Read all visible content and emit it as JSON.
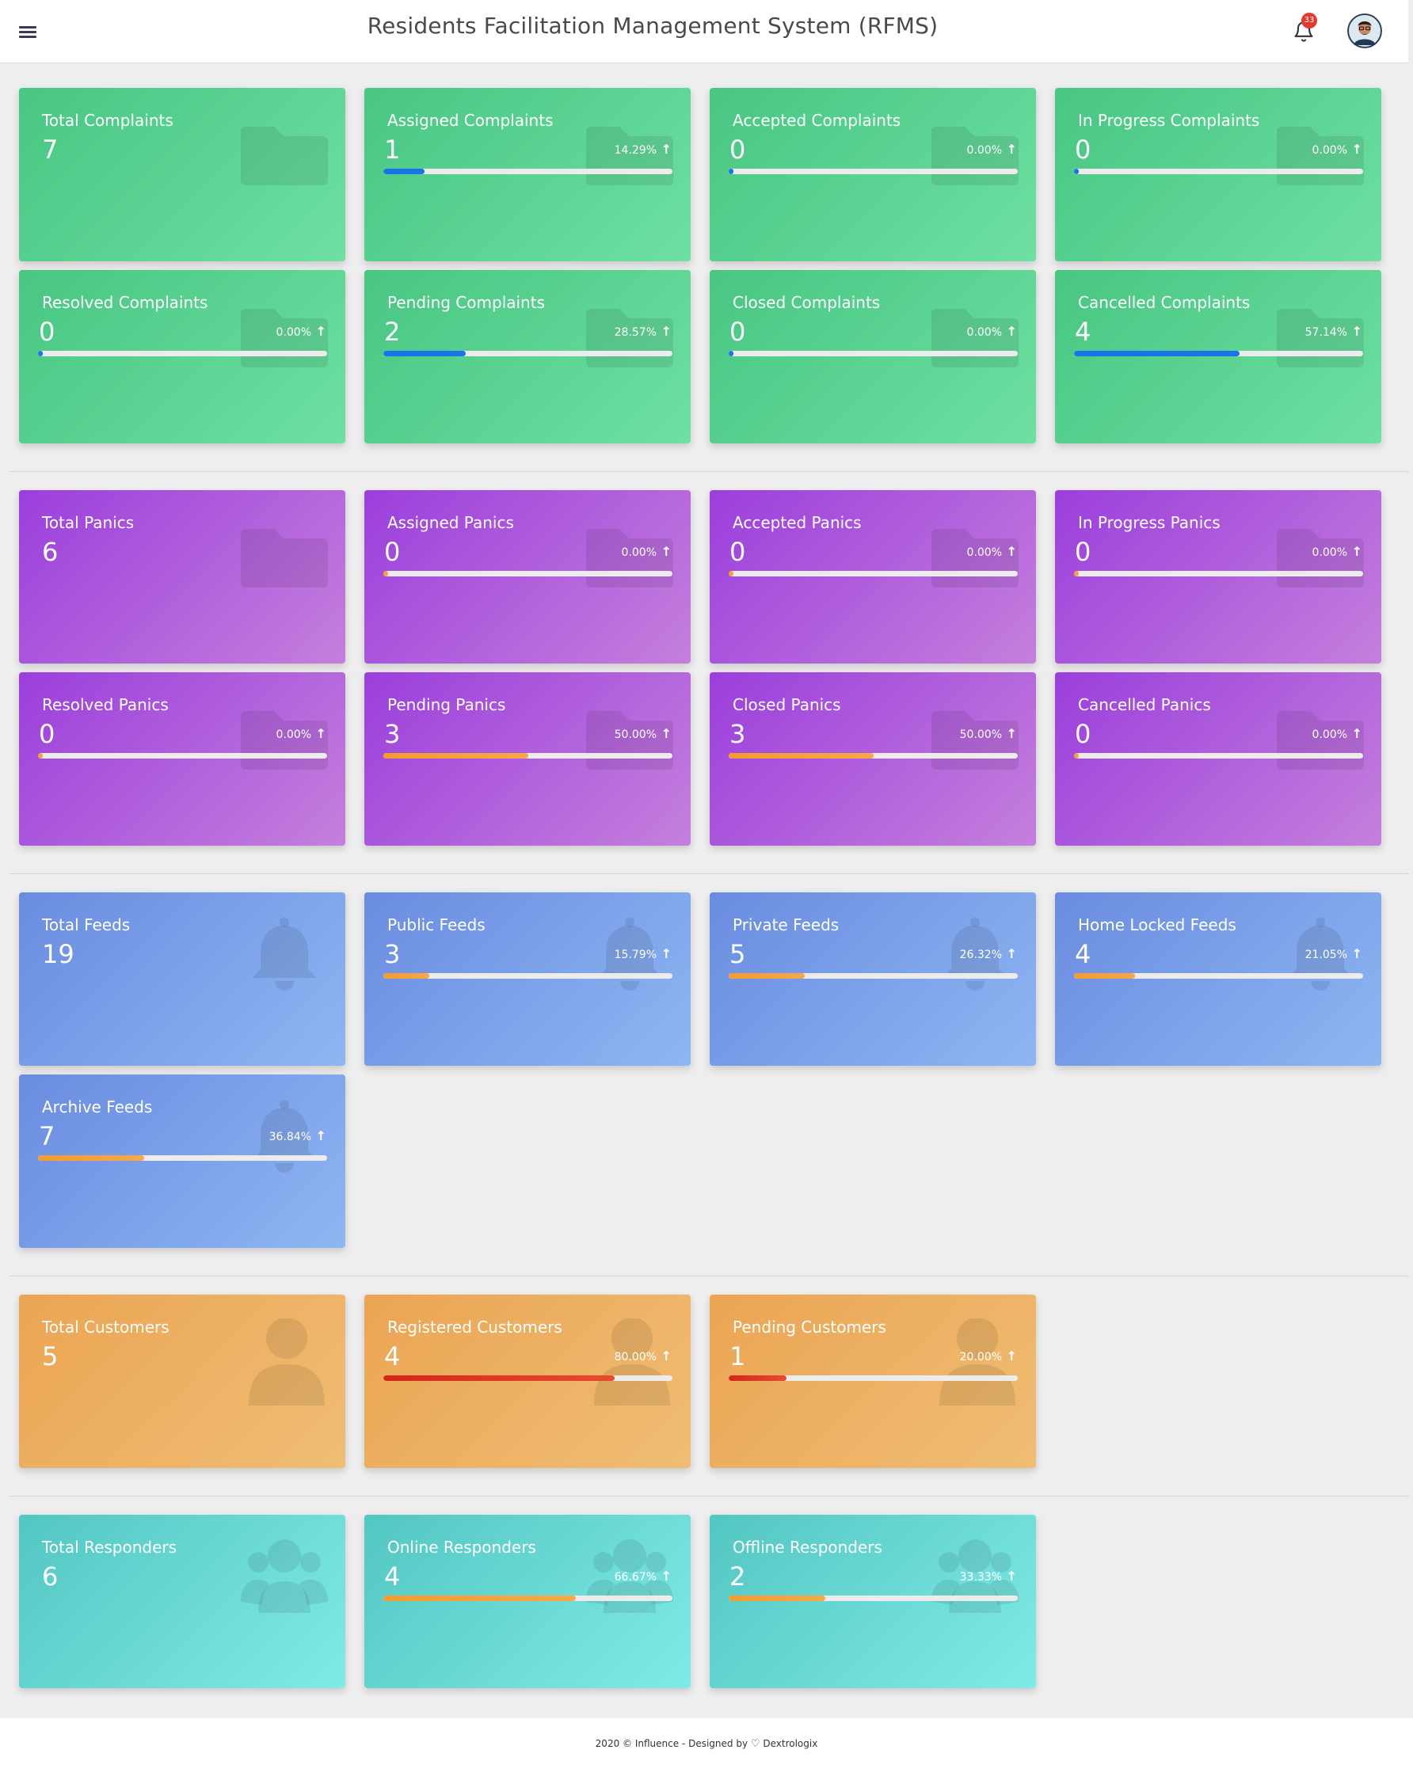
{
  "header": {
    "title": "Residents Facilitation Management System (RFMS)",
    "notification_count": "33"
  },
  "sections": [
    {
      "name": "complaints",
      "theme": "green",
      "icon": "folder-icon",
      "bar_color": "blue",
      "cards": [
        {
          "title": "Total Complaints",
          "value": "7"
        },
        {
          "title": "Assigned Complaints",
          "value": "1",
          "percent": "14.29%",
          "progress": 0.1429
        },
        {
          "title": "Accepted Complaints",
          "value": "0",
          "percent": "0.00%",
          "progress": 0
        },
        {
          "title": "In Progress Complaints",
          "value": "0",
          "percent": "0.00%",
          "progress": 0
        },
        {
          "title": "Resolved Complaints",
          "value": "0",
          "percent": "0.00%",
          "progress": 0
        },
        {
          "title": "Pending Complaints",
          "value": "2",
          "percent": "28.57%",
          "progress": 0.2857
        },
        {
          "title": "Closed Complaints",
          "value": "0",
          "percent": "0.00%",
          "progress": 0
        },
        {
          "title": "Cancelled Complaints",
          "value": "4",
          "percent": "57.14%",
          "progress": 0.5714
        }
      ]
    },
    {
      "name": "panics",
      "theme": "purple",
      "icon": "folder-icon",
      "bar_color": "orange",
      "cards": [
        {
          "title": "Total Panics",
          "value": "6"
        },
        {
          "title": "Assigned Panics",
          "value": "0",
          "percent": "0.00%",
          "progress": 0
        },
        {
          "title": "Accepted Panics",
          "value": "0",
          "percent": "0.00%",
          "progress": 0
        },
        {
          "title": "In Progress Panics",
          "value": "0",
          "percent": "0.00%",
          "progress": 0
        },
        {
          "title": "Resolved Panics",
          "value": "0",
          "percent": "0.00%",
          "progress": 0
        },
        {
          "title": "Pending Panics",
          "value": "3",
          "percent": "50.00%",
          "progress": 0.5
        },
        {
          "title": "Closed Panics",
          "value": "3",
          "percent": "50.00%",
          "progress": 0.5
        },
        {
          "title": "Cancelled Panics",
          "value": "0",
          "percent": "0.00%",
          "progress": 0
        }
      ]
    },
    {
      "name": "feeds",
      "theme": "blue",
      "icon": "bell-icon",
      "bar_color": "orange",
      "cards": [
        {
          "title": "Total Feeds",
          "value": "19"
        },
        {
          "title": "Public Feeds",
          "value": "3",
          "percent": "15.79%",
          "progress": 0.1579
        },
        {
          "title": "Private Feeds",
          "value": "5",
          "percent": "26.32%",
          "progress": 0.2632
        },
        {
          "title": "Home Locked Feeds",
          "value": "4",
          "percent": "21.05%",
          "progress": 0.2105
        },
        {
          "title": "Archive Feeds",
          "value": "7",
          "percent": "36.84%",
          "progress": 0.3684
        }
      ]
    },
    {
      "name": "customers",
      "theme": "orange",
      "icon": "user-icon",
      "bar_color": "red",
      "cards": [
        {
          "title": "Total Customers",
          "value": "5"
        },
        {
          "title": "Registered Customers",
          "value": "4",
          "percent": "80.00%",
          "progress": 0.8
        },
        {
          "title": "Pending Customers",
          "value": "1",
          "percent": "20.00%",
          "progress": 0.2
        }
      ]
    },
    {
      "name": "responders",
      "theme": "teal",
      "icon": "users-icon",
      "bar_color": "orange",
      "cards": [
        {
          "title": "Total Responders",
          "value": "6"
        },
        {
          "title": "Online Responders",
          "value": "4",
          "percent": "66.67%",
          "progress": 0.6667
        },
        {
          "title": "Offline Responders",
          "value": "2",
          "percent": "33.33%",
          "progress": 0.3333
        }
      ]
    }
  ],
  "footer": {
    "prefix": "2020 © Influence - Designed by",
    "brand": "Dextrologix"
  }
}
